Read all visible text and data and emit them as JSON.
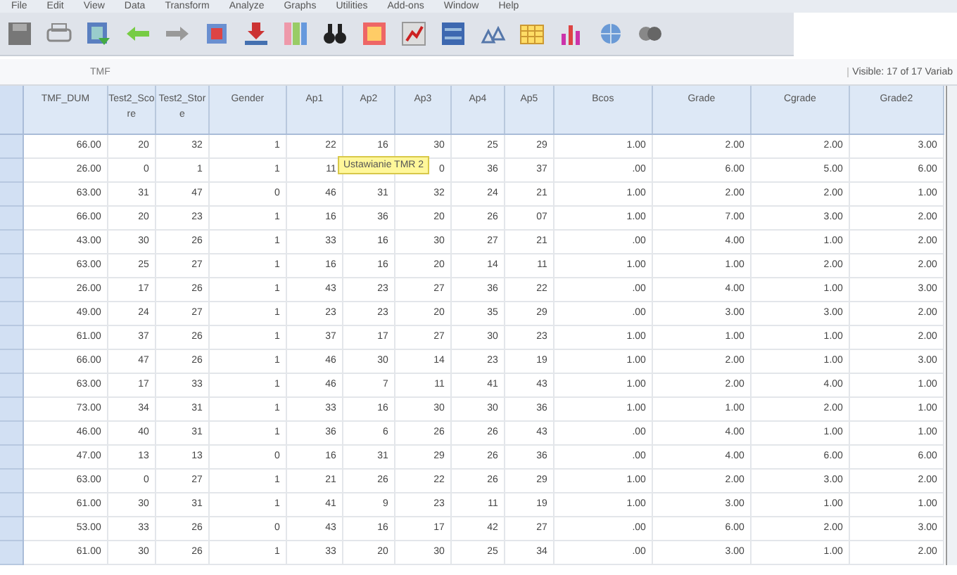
{
  "menu": [
    "File",
    "Edit",
    "View",
    "Data",
    "Transform",
    "Analyze",
    "Graphs",
    "Utilities",
    "Add-ons",
    "Window",
    "Help"
  ],
  "cell_editor": {
    "value": "TMF",
    "visible_info": "Visible: 17 of 17 Variab"
  },
  "tooltip": "Ustawianie TMR 2",
  "table": {
    "columns": [
      "TMF_DUM",
      "Test2_Score",
      "Test2_Store",
      "Gender",
      "Ap1",
      "Ap2",
      "Ap3",
      "Ap4",
      "Ap5",
      "Bcos",
      "Grade",
      "Cgrade",
      "Grade2"
    ],
    "rows": [
      [
        "66.00",
        "20",
        "32",
        "1",
        "22",
        "16",
        "30",
        "25",
        "29",
        "1.00",
        "2.00",
        "2.00",
        "3.00"
      ],
      [
        "26.00",
        "0",
        "1",
        "1",
        "11",
        null,
        "0",
        "36",
        "37",
        ".00",
        "6.00",
        "5.00",
        "6.00"
      ],
      [
        "63.00",
        "31",
        "47",
        "0",
        "46",
        "31",
        "32",
        "24",
        "21",
        "1.00",
        "2.00",
        "2.00",
        "1.00"
      ],
      [
        "66.00",
        "20",
        "23",
        "1",
        "16",
        "36",
        "20",
        "26",
        "07",
        "1.00",
        "7.00",
        "3.00",
        "2.00"
      ],
      [
        "43.00",
        "30",
        "26",
        "1",
        "33",
        "16",
        "30",
        "27",
        "21",
        ".00",
        "4.00",
        "1.00",
        "2.00"
      ],
      [
        "63.00",
        "25",
        "27",
        "1",
        "16",
        "16",
        "20",
        "14",
        "11",
        "1.00",
        "1.00",
        "2.00",
        "2.00"
      ],
      [
        "26.00",
        "17",
        "26",
        "1",
        "43",
        "23",
        "27",
        "36",
        "22",
        ".00",
        "4.00",
        "1.00",
        "3.00"
      ],
      [
        "49.00",
        "24",
        "27",
        "1",
        "23",
        "23",
        "20",
        "35",
        "29",
        ".00",
        "3.00",
        "3.00",
        "2.00"
      ],
      [
        "61.00",
        "37",
        "26",
        "1",
        "37",
        "17",
        "27",
        "30",
        "23",
        "1.00",
        "1.00",
        "1.00",
        "2.00"
      ],
      [
        "66.00",
        "47",
        "26",
        "1",
        "46",
        "30",
        "14",
        "23",
        "19",
        "1.00",
        "2.00",
        "1.00",
        "3.00"
      ],
      [
        "63.00",
        "17",
        "33",
        "1",
        "46",
        "7",
        "11",
        "41",
        "43",
        "1.00",
        "2.00",
        "4.00",
        "1.00"
      ],
      [
        "73.00",
        "34",
        "31",
        "1",
        "33",
        "16",
        "30",
        "30",
        "36",
        "1.00",
        "1.00",
        "2.00",
        "1.00"
      ],
      [
        "46.00",
        "40",
        "31",
        "1",
        "36",
        "6",
        "26",
        "26",
        "43",
        ".00",
        "4.00",
        "1.00",
        "1.00"
      ],
      [
        "47.00",
        "13",
        "13",
        "0",
        "16",
        "31",
        "29",
        "26",
        "36",
        ".00",
        "4.00",
        "6.00",
        "6.00"
      ],
      [
        "63.00",
        "0",
        "27",
        "1",
        "21",
        "26",
        "22",
        "26",
        "29",
        "1.00",
        "2.00",
        "3.00",
        "2.00"
      ],
      [
        "61.00",
        "30",
        "31",
        "1",
        "41",
        "9",
        "23",
        "11",
        "19",
        "1.00",
        "3.00",
        "1.00",
        "1.00"
      ],
      [
        "53.00",
        "33",
        "26",
        "0",
        "43",
        "16",
        "17",
        "42",
        "27",
        ".00",
        "6.00",
        "2.00",
        "3.00"
      ],
      [
        "61.00",
        "30",
        "26",
        "1",
        "33",
        "20",
        "30",
        "25",
        "34",
        ".00",
        "3.00",
        "1.00",
        "2.00"
      ]
    ]
  }
}
